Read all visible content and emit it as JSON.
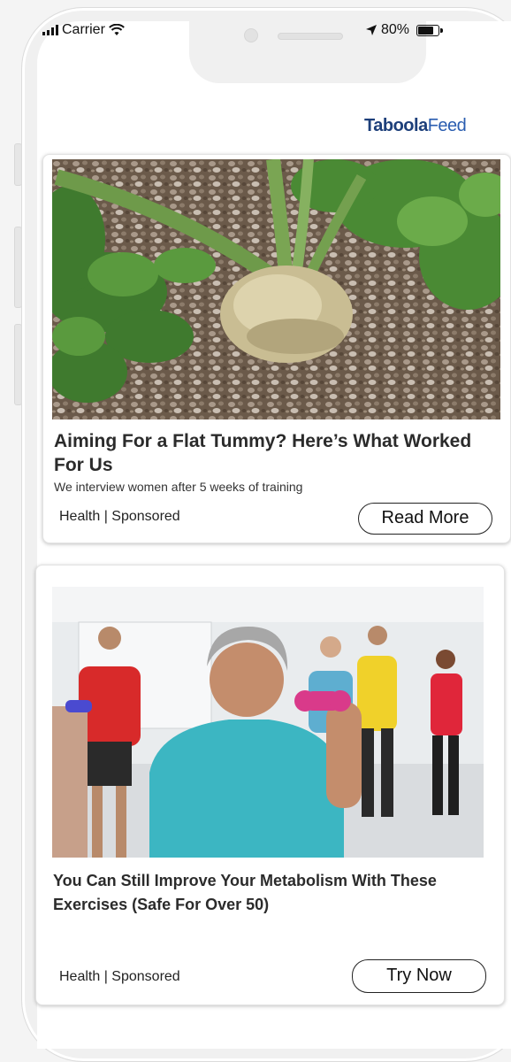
{
  "status_bar": {
    "carrier": "Carrier",
    "battery": "80%"
  },
  "brand": {
    "name": "Taboola",
    "suffix": "Feed",
    "colors": {
      "taboola": "#1d3f7a",
      "feed": "#2a5db0"
    }
  },
  "cards": [
    {
      "image": "celeriac root growing in gravel with green leaves",
      "title": "Aiming For a Flat Tummy? Here’s What Worked For Us",
      "description": "We interview women after 5 weeks of training",
      "category": "Health | Sponsored",
      "cta": "Read More"
    },
    {
      "image": "smiling older woman lifting pink dumbbell in fitness class",
      "title": "You Can Still Improve Your Metabolism With These Exercises (Safe For Over 50)",
      "category": "Health | Sponsored",
      "cta": "Try Now"
    }
  ]
}
